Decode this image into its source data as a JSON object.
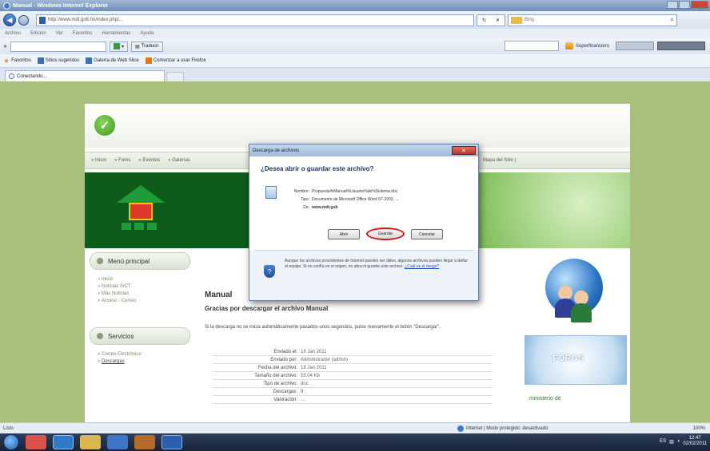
{
  "window": {
    "title": "Manual - Windows Internet Explorer"
  },
  "address_bar": {
    "url": "http://www.mdt.gob.hn/index.php/...",
    "search_engine": "Bing"
  },
  "menu": {
    "items": [
      "Archivo",
      "Edición",
      "Ver",
      "Favoritos",
      "Herramientas",
      "Ayuda"
    ]
  },
  "toolbar": {
    "translate_label": "Traducir",
    "super_label": "Superfinanciero"
  },
  "favorites_bar": {
    "favorites_label": "Favoritos",
    "items": [
      "Sitios sugeridos",
      "Galería de Web Slice",
      "Comenzar a usar Firefox"
    ]
  },
  "tab": {
    "label": "Conectando..."
  },
  "site": {
    "nav_items": [
      "Inicio",
      "Foros",
      "Eventos",
      "Galerías"
    ],
    "nav_right": "Mapa del Sitio",
    "sidebar": {
      "menu_title": "Menú principal",
      "menu_items": [
        "Inicio",
        "Noticias SICT",
        "Más Noticias",
        "Acceso - Correo"
      ],
      "services_title": "Servicios",
      "services_items": [
        "Correo Electrónico",
        "Descargas"
      ]
    },
    "main": {
      "title": "Manual",
      "subtitle": "Gracias por descargar el archivo Manual",
      "text": "Si la descarga no se inicia automáticamente pasados unos segundos, pulse nuevamente el botón \"Descargar\".",
      "info": [
        {
          "k": "Enviado el:",
          "v": "18 Jan 2011"
        },
        {
          "k": "Enviado por:",
          "v": "Administrador (admin)"
        },
        {
          "k": "Fecha del archivo:",
          "v": "18 Jan 2011"
        },
        {
          "k": "Tamaño del archivo:",
          "v": "55.04 Kb"
        },
        {
          "k": "Tipo de archivo:",
          "v": "doc"
        },
        {
          "k": "Descargas:",
          "v": "8"
        },
        {
          "k": "Valoración:",
          "v": "..."
        }
      ]
    },
    "foros_label": "FOROS",
    "bottom_logo": "ministerio de"
  },
  "dialog": {
    "title": "Descarga de archivos",
    "close_label": "✕",
    "question": "¿Desea abrir o guardar este archivo?",
    "fields": [
      {
        "k": "Nombre:",
        "v": "Propuesta%Manual%Usuario%de%Sistema.doc",
        "bold": false
      },
      {
        "k": "Tipo:",
        "v": "Documento de Microsoft Office Word 97-2003, ...",
        "bold": false
      },
      {
        "k": "De:",
        "v": "www.mdt.gob",
        "bold": true
      }
    ],
    "buttons": {
      "open": "Abrir",
      "save": "Guardar",
      "cancel": "Cancelar"
    },
    "warning": "Aunque los archivos procedentes de Internet pueden ser útiles, algunos archivos pueden llegar a dañar el equipo. Si no confía en el origen, no abra ni guarde este archivo.",
    "warning_link": "¿Cuál es el riesgo?"
  },
  "status_bar": {
    "left": "Listo",
    "zone": "Internet | Modo protegido: desactivado",
    "zoom": "100%"
  },
  "taskbar": {
    "time": "12:47",
    "date": "02/02/2011"
  }
}
